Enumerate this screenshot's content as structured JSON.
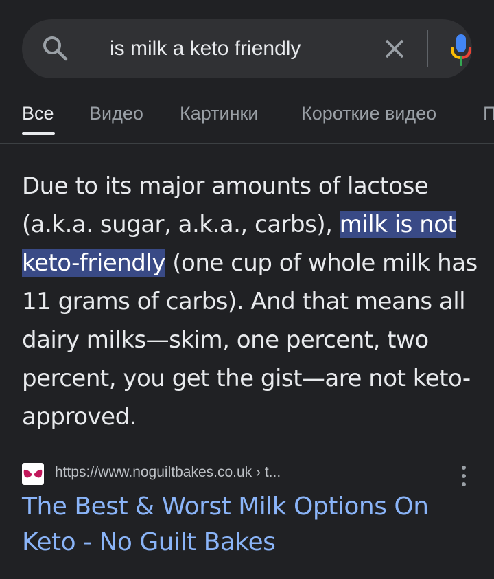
{
  "search": {
    "query": "is milk a keto friendly",
    "icons": [
      "search-icon",
      "close-icon",
      "mic-icon"
    ]
  },
  "tabs": [
    {
      "label": "Все",
      "active": true
    },
    {
      "label": "Видео",
      "active": false
    },
    {
      "label": "Картинки",
      "active": false
    },
    {
      "label": "Короткие видео",
      "active": false
    },
    {
      "label": "П",
      "active": false
    }
  ],
  "snippet": {
    "before": "Due to its major amounts of lactose (a.k.a. sugar, a.k.a., carbs), ",
    "highlight": "milk is not keto-friendly",
    "after": " (one cup of whole milk has 11 grams of carbs). And that means all dairy milks—skim, one percent, two percent, you get the gist—are not keto-approved."
  },
  "result": {
    "url": "https://www.noguiltbakes.co.uk › t...",
    "title": "The Best & Worst Milk Options On Keto - No Guilt Bakes"
  },
  "colors": {
    "background": "#202124",
    "searchbar": "#303134",
    "link": "#8ab4f8",
    "highlight": "#394a86",
    "favicon": "#c2185b"
  }
}
